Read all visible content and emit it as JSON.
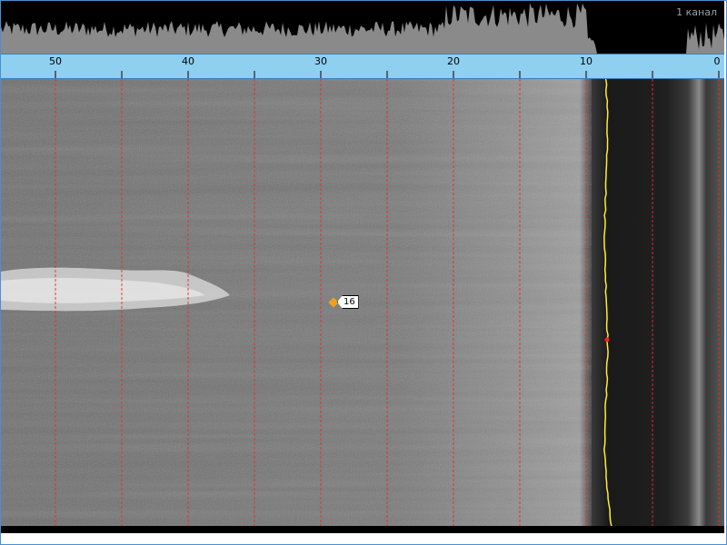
{
  "channel_label": "1 канал",
  "ruler": {
    "ticks": [
      {
        "label": "50",
        "value": 50
      },
      {
        "label": "40",
        "value": 40
      },
      {
        "label": "30",
        "value": 30
      },
      {
        "label": "20",
        "value": 20
      },
      {
        "label": "10",
        "value": 10
      },
      {
        "label": "0",
        "value": 0
      }
    ]
  },
  "marker": {
    "label": "16"
  },
  "colors": {
    "ruler_bg": "#8fcff0",
    "grid_line": "#e23030",
    "bottom_track": "#ffee33",
    "amplitude": "#8a8a8a",
    "marker": "#f0a020"
  }
}
